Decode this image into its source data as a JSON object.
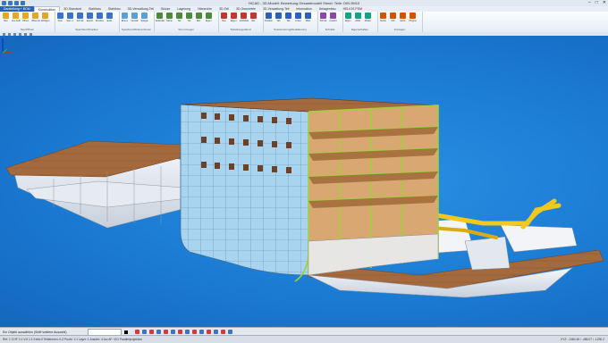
{
  "titlebar": {
    "title": "HiCAD - 3D-Modell: Bewertung Gesamtmodell Sheet: Teile: DIN 0M10",
    "minimize": "–",
    "maximize": "□",
    "close": "✕"
  },
  "tabs": [
    {
      "label": "Darstellung + BOM",
      "active": false,
      "menu": true
    },
    {
      "label": "Konstruktion",
      "active": true
    },
    {
      "label": "3D-Standard",
      "active": false
    },
    {
      "label": "Stahlbau",
      "active": false
    },
    {
      "label": "Stahlbau",
      "active": false
    },
    {
      "label": "3D-Verwaltung-Teil",
      "active": false
    },
    {
      "label": "Skizze",
      "active": false
    },
    {
      "label": "Lagerung",
      "active": false
    },
    {
      "label": "Hierarchie",
      "active": false
    },
    {
      "label": "3D-Teil",
      "active": false
    },
    {
      "label": "3D-Geometrie",
      "active": false
    },
    {
      "label": "3D-Verwaltung-Teil",
      "active": false
    },
    {
      "label": "Information",
      "active": false
    },
    {
      "label": "Anlagenbau",
      "active": false
    },
    {
      "label": "HELIOS PDM",
      "active": false
    }
  ],
  "ribbon_groups": [
    {
      "name": "Neu/Öffnen",
      "buttons": [
        "Neu",
        "Neu Aufb.",
        "Öffnen",
        "Öffnen Ex.",
        "Einfügen"
      ],
      "color": "#e3a629"
    },
    {
      "name": "Speichern/Drucken",
      "buttons": [
        "Spei.",
        "Spei. u.",
        "Schnitt",
        "Export",
        "Drucken",
        "Ende"
      ],
      "color": "#3b74c4"
    },
    {
      "name": "Speichern/Referenzieren",
      "buttons": [
        "Ebene",
        "Versatz",
        "Spiegel"
      ],
      "color": "#5aa0d8"
    },
    {
      "name": "Teil erzeugen",
      "buttons": [
        "Teilstruktur",
        "Name",
        "Teil",
        "Teil",
        "Bez.",
        "Eigen."
      ],
      "color": "#4a8c3a"
    },
    {
      "name": "Teileübergreifend",
      "buttons": [
        "Neu",
        "Eigen.",
        "Stückliste",
        "Ref."
      ],
      "color": "#c0392b"
    },
    {
      "name": "Positionierung/Detaillierung",
      "buttons": [
        "Position",
        "Tab",
        "Tab",
        "Linien",
        "Mark"
      ],
      "color": "#2c62b5"
    },
    {
      "name": "Schnitte",
      "buttons": [
        "Schnitt",
        "Ansicht"
      ],
      "color": "#8e44ad"
    },
    {
      "name": "Eigenschaften",
      "buttons": [
        "Eigen.",
        "Attrib.",
        "Model."
      ],
      "color": "#16a085"
    },
    {
      "name": "Anzeigen",
      "buttons": [
        "Suche",
        "Info",
        "Extra",
        "Plugins"
      ],
      "color": "#d35400"
    }
  ],
  "statusbar": {
    "command_prompt": "Ein Objekt auswählen (Shift+weitere Auswahl)",
    "info_left": "Ref: 1 3   HF 0.1   V:0   1:1   Kreis:0   Teilebenen: 0-2   Punkt: 1:1   Layer: 1   Ansicht: 4-Iso   AF: ISO Parallelprojektion",
    "info_right": "XYZ: -1384.45 / -486.07 / -1290.2"
  }
}
